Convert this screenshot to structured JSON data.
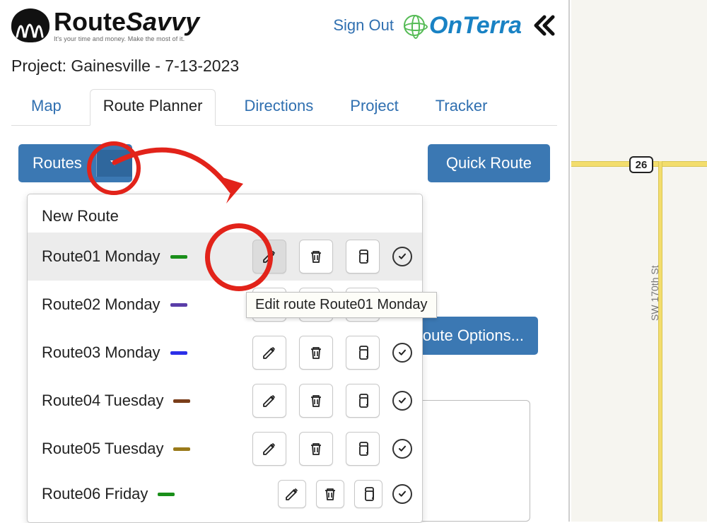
{
  "brand": {
    "route": "Route",
    "savvy": "Savvy",
    "tagline": "It's your time and money. Make the most of it."
  },
  "header": {
    "sign_out": "Sign Out",
    "partner": "OnTerra"
  },
  "project_title": "Project: Gainesville - 7-13-2023",
  "tabs": {
    "map": "Map",
    "route_planner": "Route Planner",
    "directions": "Directions",
    "project": "Project",
    "tracker": "Tracker"
  },
  "buttons": {
    "routes": "Routes",
    "quick_route": "Quick Route",
    "route_options": "Route Options..."
  },
  "dropdown": {
    "new_route": "New Route",
    "routes": [
      {
        "label": "Route01 Monday",
        "color": "#1a8f1a",
        "hovered": true
      },
      {
        "label": "Route02 Monday",
        "color": "#5a3da8",
        "hovered": false
      },
      {
        "label": "Route03 Monday",
        "color": "#2b2fe8",
        "hovered": false
      },
      {
        "label": "Route04 Tuesday",
        "color": "#7a3e1a",
        "hovered": false
      },
      {
        "label": "Route05 Tuesday",
        "color": "#9a7a1a",
        "hovered": false
      },
      {
        "label": "Route06 Friday",
        "color": "#1a8f1a",
        "hovered": false,
        "small": true
      }
    ]
  },
  "tooltip": "Edit route Route01 Monday",
  "map": {
    "highway_number": "26",
    "street_label": "SW 170th St"
  },
  "colors": {
    "primary": "#3b78b3",
    "link": "#2f6fb0",
    "annotation": "#e2231a"
  }
}
